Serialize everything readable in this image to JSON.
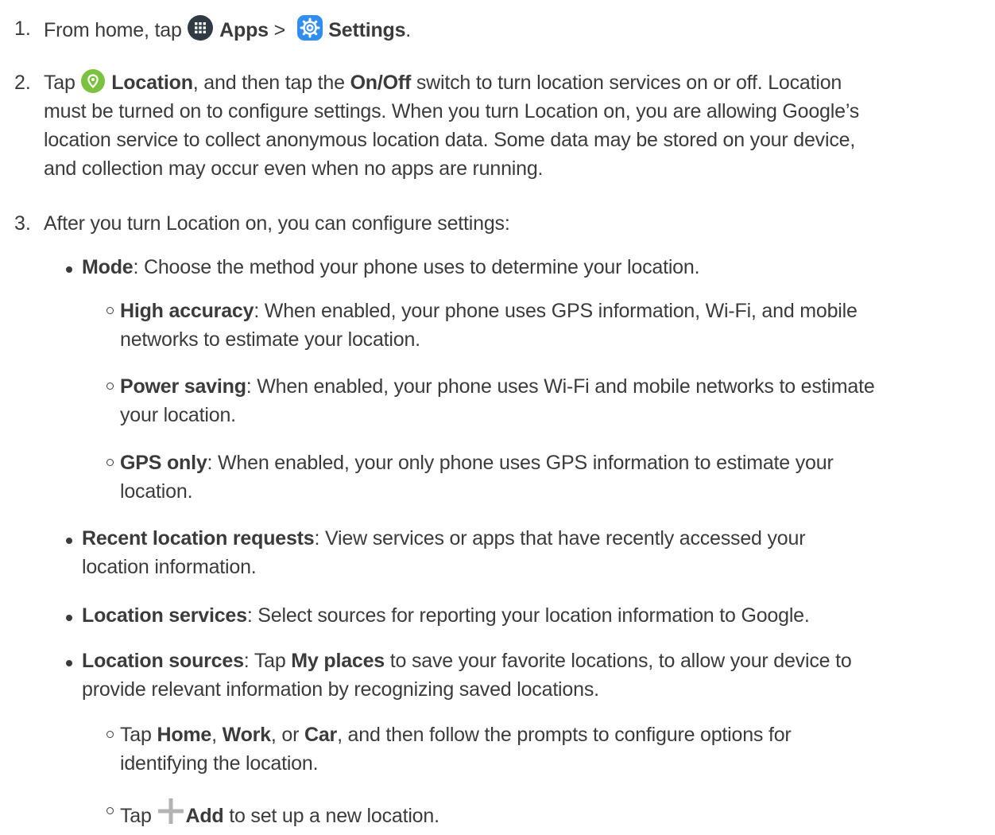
{
  "steps": [
    {
      "number": "1.",
      "pre": "From home, tap ",
      "apps_label": "Apps",
      "sep": " > ",
      "settings_label": "Settings",
      "post": "."
    },
    {
      "number": "2.",
      "pre": "Tap ",
      "location_label": "Location",
      "mid": ", and then tap the ",
      "onoff_label": "On/Off",
      "line1_rest": " switch to turn location services on or off. Location",
      "line2": "must be turned on to configure settings. When you turn Location on, you are allowing Google’s",
      "line3": "location service to collect anonymous location data. Some data may be stored on your device,",
      "line4": "and collection may occur even when no apps are running."
    },
    {
      "number": "3.",
      "text": "After you turn Location on, you can configure settings:"
    }
  ],
  "bullets": {
    "mode": {
      "label": "Mode",
      "text": ": Choose the method your phone uses to determine your location."
    },
    "high_accuracy": {
      "label": "High accuracy",
      "line1": ": When enabled, your phone uses GPS information, Wi-Fi, and mobile",
      "line2": "networks to estimate your location."
    },
    "power_saving": {
      "label": "Power saving",
      "line1": ": When enabled, your phone uses Wi-Fi and mobile networks to estimate",
      "line2": "your location."
    },
    "gps_only": {
      "label": "GPS only",
      "line1": ": When enabled, your only phone uses GPS information to estimate your",
      "line2": "location."
    },
    "recent_requests": {
      "label": "Recent location requests",
      "line1": ": View services or apps that have recently accessed your",
      "line2": "location information."
    },
    "location_services": {
      "label": "Location services",
      "text": ": Select sources for reporting your location information to Google."
    },
    "location_sources": {
      "label": "Location sources",
      "pre": ": Tap ",
      "my_places": "My places",
      "line1_rest": " to save your favorite locations, to allow your device to",
      "line2": "provide relevant information by recognizing saved locations."
    },
    "home_work_car": {
      "pre": "Tap ",
      "home": "Home",
      "c1": ", ",
      "work": "Work",
      "c2": ", or ",
      "car": "Car",
      "line1_rest": ", and then follow the prompts to configure options for",
      "line2": "identifying the location."
    },
    "add": {
      "pre": "Tap ",
      "add_label": "Add",
      "text": " to set up a new location."
    }
  },
  "icons": {
    "apps": "apps-grid-icon",
    "settings": "settings-gear-icon",
    "location": "location-pin-icon",
    "add": "plus-icon"
  },
  "colors": {
    "text": "#3b3b3b",
    "apps_icon": "#2f3a45",
    "settings_icon": "#2f8ef0",
    "location_icon": "#7cc241",
    "plus_icon": "#b3b3b3"
  }
}
